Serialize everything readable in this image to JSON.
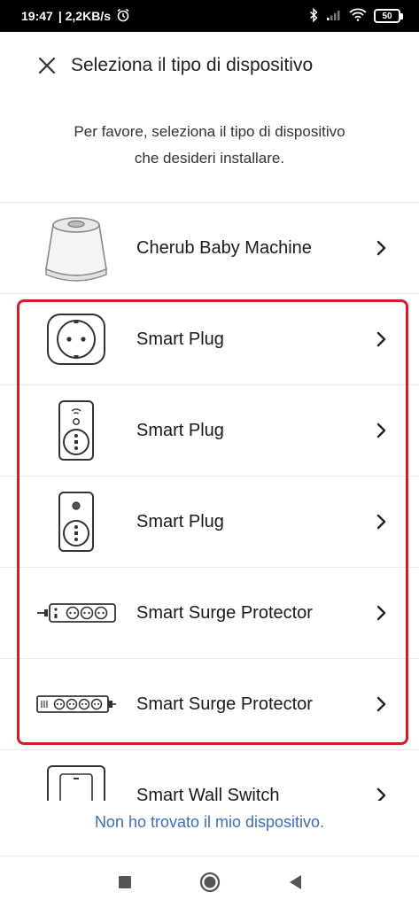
{
  "status_bar": {
    "time": "19:47",
    "network_speed": "| 2,2KB/s",
    "battery_level": "50",
    "icons": [
      "alarm-icon",
      "bluetooth-icon",
      "signal-icon",
      "wifi-icon",
      "battery-icon"
    ]
  },
  "header": {
    "title": "Seleziona il tipo di dispositivo",
    "close_icon": "close-icon"
  },
  "intro": {
    "line1": "Per favore, seleziona il tipo di dispositivo",
    "line2": "che desideri installare."
  },
  "devices": [
    {
      "label": "Cherub Baby Machine",
      "icon": "baby-machine-icon"
    },
    {
      "label": "Smart Plug",
      "icon": "round-plug-icon"
    },
    {
      "label": "Smart Plug",
      "icon": "tall-plug-wifi-icon"
    },
    {
      "label": "Smart Plug",
      "icon": "tall-plug-button-icon"
    },
    {
      "label": "Smart Surge Protector",
      "icon": "power-strip-3-icon"
    },
    {
      "label": "Smart Surge Protector",
      "icon": "power-strip-4-icon"
    },
    {
      "label": "Smart Wall Switch",
      "icon": "wall-switch-icon"
    }
  ],
  "footer": {
    "link": "Non ho trovato il mio dispositivo."
  },
  "colors": {
    "highlight": "#d9192e",
    "link": "#3d6fb4"
  },
  "nav_bar": {
    "icons": [
      "recents-square-icon",
      "home-circle-icon",
      "back-triangle-icon"
    ]
  }
}
